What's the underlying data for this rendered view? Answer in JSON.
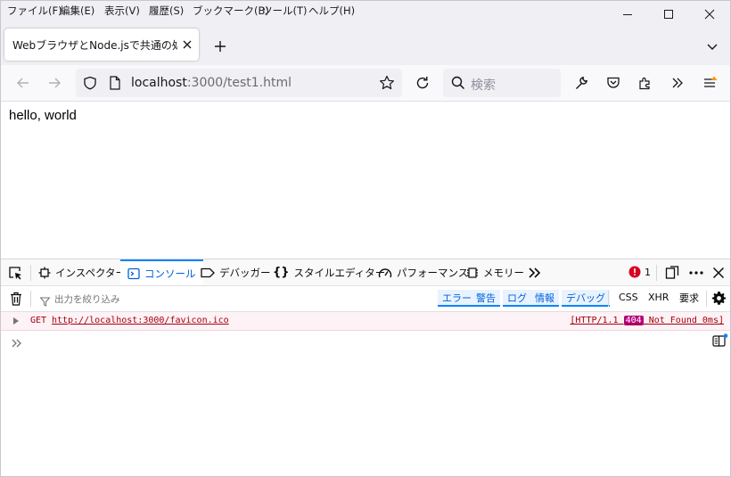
{
  "menu": [
    "ファイル(F)",
    "編集(E)",
    "表示(V)",
    "履歴(S)",
    "ブックマーク(B)",
    "ツール(T)",
    "ヘルプ(H)"
  ],
  "tab": {
    "title": "WebブラウザとNode.jsで共通の処理を"
  },
  "url": {
    "host": "localhost",
    "rest": ":3000/test1.html"
  },
  "search": {
    "placeholder": "検索"
  },
  "page": {
    "text": "hello, world"
  },
  "devtools": {
    "tabs": [
      "インスペクター",
      "コンソール",
      "デバッガー",
      "スタイルエディター",
      "パフォーマンス",
      "メモリー"
    ],
    "selected_tab": "コンソール",
    "error_count": "1",
    "filter_placeholder": "出力を絞り込み",
    "filters": [
      "エラー",
      "警告",
      "ログ",
      "情報",
      "デバッグ"
    ],
    "extra_filters": [
      "CSS",
      "XHR",
      "要求"
    ],
    "message": {
      "method": "GET",
      "url": "http://localhost:3000/favicon.ico",
      "status_prefix": "[HTTP/1.1",
      "status_code": "404",
      "status_suffix": "Not Found 0ms]"
    }
  },
  "colors": {
    "accent": "#0a84ff",
    "error": "#a4000f",
    "badge": "#b5007f"
  }
}
